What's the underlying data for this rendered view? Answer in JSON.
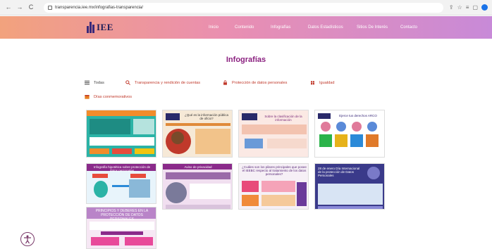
{
  "browser": {
    "url": "transparencia.iee.mx/infografias-transparencia/",
    "nav": {
      "back": "←",
      "forward": "→",
      "reload": "C"
    },
    "icons": [
      "share-icon",
      "star-icon",
      "sidepanel-icon",
      "window-icon",
      "profile-icon"
    ]
  },
  "header": {
    "logo_text": "IEE",
    "menu": [
      "Inicio",
      "Contenido",
      "Infografías",
      "Datos Estadísticos",
      "Sitios De Interés",
      "Contacto"
    ]
  },
  "page": {
    "title": "Infografías"
  },
  "filters": [
    {
      "label": "Todas",
      "icon": "list-icon"
    },
    {
      "label": "Transparencia y rendición de cuentas",
      "icon": "search-icon"
    },
    {
      "label": "Protección de datos personales",
      "icon": "lock-icon"
    },
    {
      "label": "Igualdad",
      "icon": "people-icon"
    },
    {
      "label": "Días conmemorativos",
      "icon": "calendar-icon"
    }
  ],
  "cards": [
    {
      "heading": ""
    },
    {
      "heading": "¿Qué es la información pública de oficio?"
    },
    {
      "heading": "Sobre la clasificación de la información"
    },
    {
      "heading": "Ejerce tus derechos ARCO"
    },
    {
      "heading": "Infografía hipotética sobre protección de datos personales"
    },
    {
      "heading": "Aviso de privacidad"
    },
    {
      "heading": "¿Cuáles son los pilares principales que posee el IEEBC respecto al tratamiento de los datos personales?"
    },
    {
      "heading": "28 de enero Día Internacional de la protección de Datos Personales"
    },
    {
      "heading": "PRINCIPIOS Y DEBERES EN LA PROTECCIÓN DE DATOS PERSONALES"
    }
  ],
  "colors": {
    "accent": "#8a1f7f",
    "filter_text": "#c0392b",
    "header_start": "#f2a27d",
    "header_mid": "#ea8fb0",
    "header_end": "#c88ad8"
  }
}
